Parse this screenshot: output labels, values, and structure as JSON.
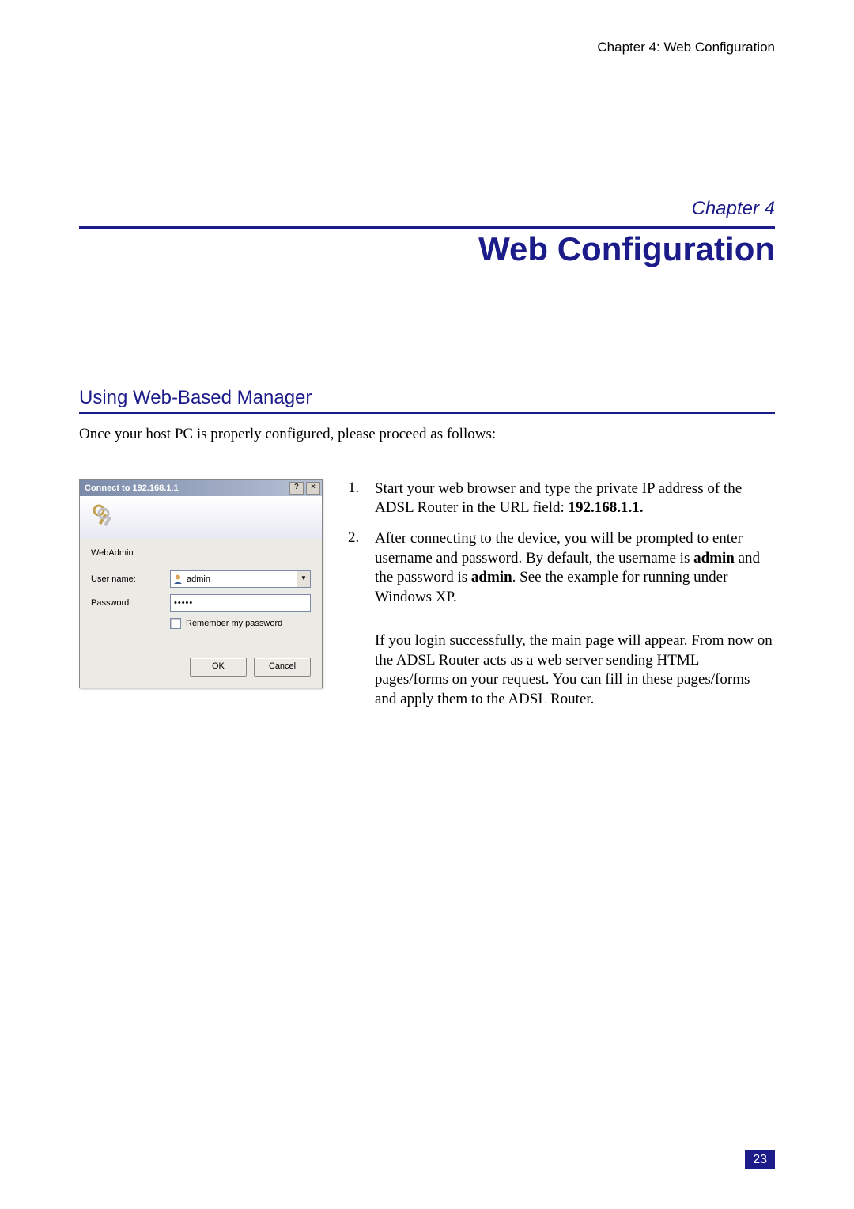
{
  "header": {
    "text": "Chapter 4: Web Configuration"
  },
  "chapter": {
    "label": "Chapter 4",
    "title": "Web Configuration"
  },
  "section": {
    "heading": "Using Web-Based Manager",
    "intro": "Once your host PC is properly configured, please proceed as follows:"
  },
  "dialog": {
    "title": "Connect to 192.168.1.1",
    "help_glyph": "?",
    "close_glyph": "×",
    "subtitle": "WebAdmin",
    "username_label": "User name:",
    "username_value": "admin",
    "password_label": "Password:",
    "password_value": "•••••",
    "remember_label": "Remember my password",
    "dropdown_glyph": "▼",
    "ok_label": "OK",
    "cancel_label": "Cancel"
  },
  "steps": {
    "item1": {
      "num": "1.",
      "t1": "Start your web browser and type the private IP address of the ADSL Router in the URL field: ",
      "bold1": "192.168.1.1."
    },
    "item2": {
      "num": "2.",
      "t1": "After connecting to the device, you will be prompted to enter username and password. By default, the username is ",
      "bold1": "admin",
      "t2": " and the password is ",
      "bold2": "admin",
      "t3": ". See the example for running under Windows XP."
    },
    "para": "If you login successfully, the main page will appear. From now on the ADSL Router acts as a web server sending HTML pages/forms on your request. You can fill in these pages/forms and apply them to the ADSL Router."
  },
  "page_number": "23"
}
